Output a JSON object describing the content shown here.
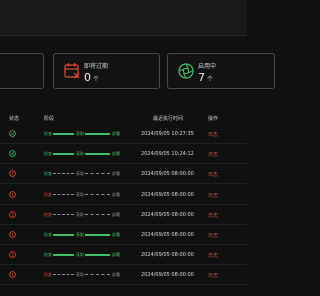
{
  "cards": {
    "expiring": {
      "label": "即将过期",
      "count": "0",
      "unit": "个",
      "icon": "calendar-x-icon",
      "color": "#e24a3b"
    },
    "enabled": {
      "label": "启用中",
      "count": "7",
      "unit": "个",
      "icon": "aperture-icon",
      "color": "#3ec06a"
    }
  },
  "table": {
    "headers": {
      "status": "状态",
      "stage": "阶段",
      "last_run": "最近执行时间",
      "actions": "操作"
    },
    "stage_labels": [
      "检查",
      "获取",
      "部署"
    ],
    "rows": [
      {
        "status": "success",
        "stages": [
          "success",
          "success",
          "success"
        ],
        "time": "2024/09/05 10:27:35",
        "action": "日志"
      },
      {
        "status": "success",
        "stages": [
          "success",
          "success",
          "success"
        ],
        "time": "2024/09/05 10:24:12",
        "action": "日志"
      },
      {
        "status": "failed",
        "stages": [
          "success",
          "pending",
          "pending"
        ],
        "time": "2024/09/05 08:00:00",
        "action": "日志"
      },
      {
        "status": "failed",
        "stages": [
          "failed",
          "pending",
          "pending"
        ],
        "time": "2024/09/05 08:00:00",
        "action": "日志"
      },
      {
        "status": "failed",
        "stages": [
          "failed",
          "pending",
          "pending"
        ],
        "time": "2024/09/05 08:00:00",
        "action": "日志"
      },
      {
        "status": "failed",
        "stages": [
          "success",
          "success",
          "success"
        ],
        "time": "2024/09/05 08:00:00",
        "action": "日志"
      },
      {
        "status": "failed",
        "stages": [
          "success",
          "success",
          "success"
        ],
        "time": "2024/09/05 08:00:00",
        "action": "日志"
      },
      {
        "status": "failed",
        "stages": [
          "failed",
          "pending",
          "pending"
        ],
        "time": "2024/09/05 08:00:00",
        "action": "日志"
      }
    ]
  },
  "colors": {
    "success": "#3ec06a",
    "failed": "#e24a3b",
    "pending": "#8a8f94",
    "link": "#e24a3b"
  }
}
